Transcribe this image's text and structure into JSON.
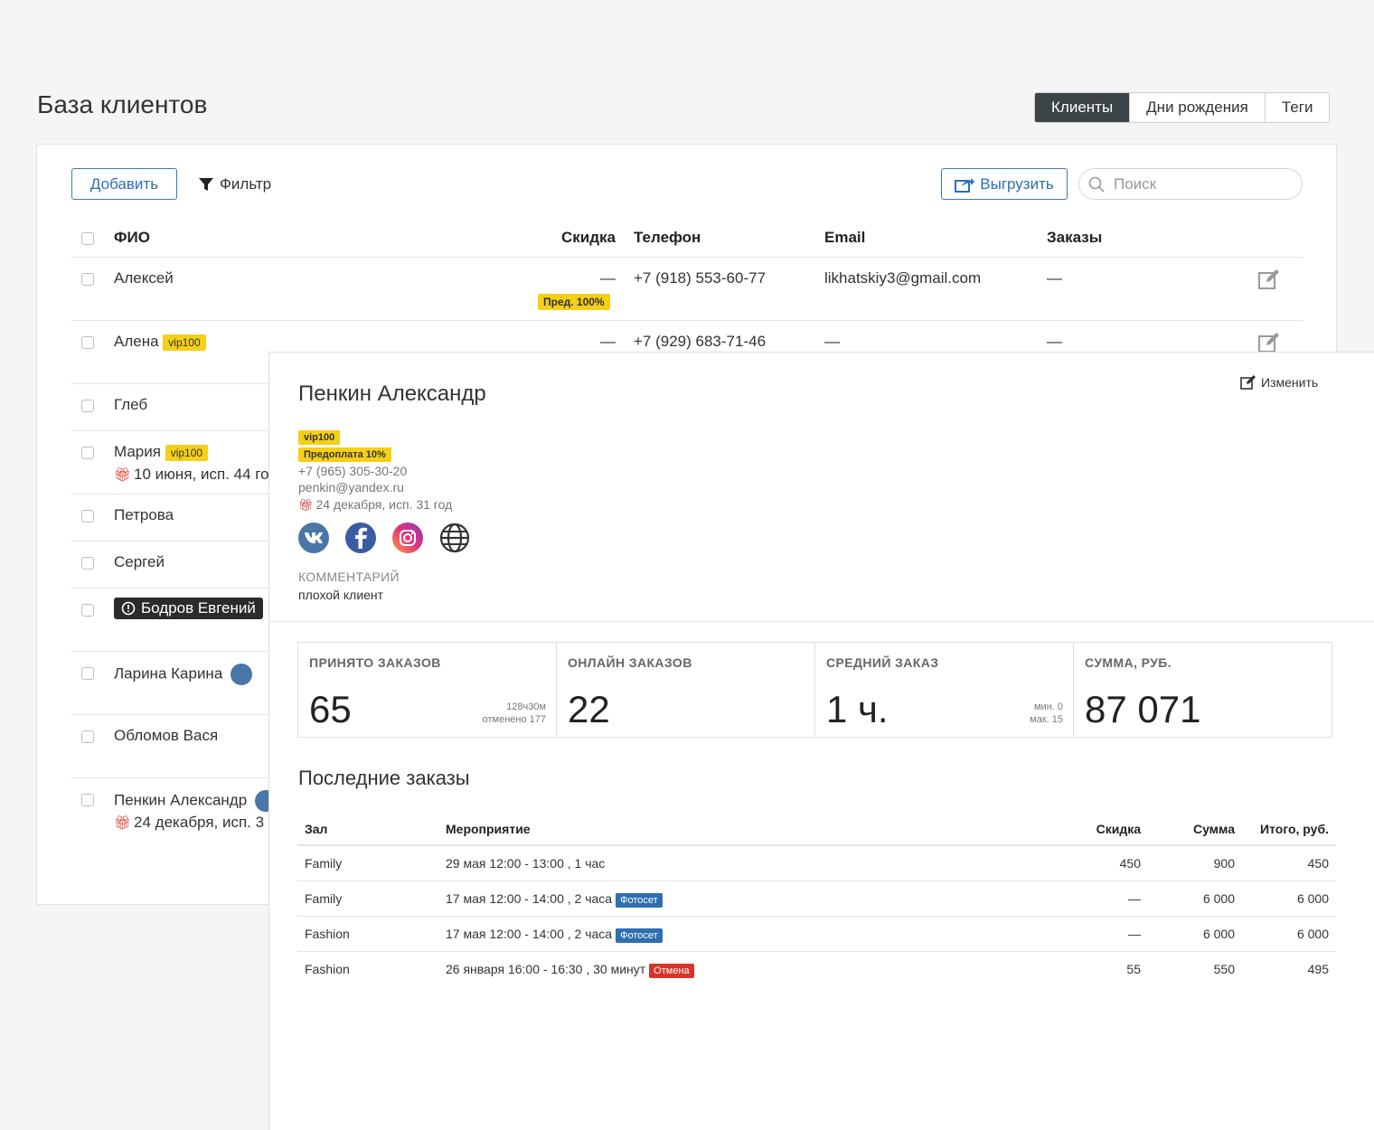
{
  "page": {
    "title": "База клиентов"
  },
  "view_tabs": [
    {
      "label": "Клиенты",
      "active": true
    },
    {
      "label": "Дни рождения",
      "active": false
    },
    {
      "label": "Теги",
      "active": false
    }
  ],
  "toolbar": {
    "add_label": "Добавить",
    "filter_label": "Фильтр",
    "export_label": "Выгрузить",
    "search_placeholder": "Поиск"
  },
  "table": {
    "headers": {
      "name": "ФИО",
      "discount": "Скидка",
      "phone": "Телефон",
      "email": "Email",
      "orders": "Заказы"
    },
    "rows": [
      {
        "name": "Алексей",
        "discount": "—",
        "discount_tag": "Пред. 100%",
        "phone": "+7 (918) 553-60-77",
        "email": "likhatskiy3@gmail.com",
        "orders": "—"
      },
      {
        "name": "Алена",
        "tag": "vip100",
        "discount": "—",
        "phone": "+7 (929) 683-71-46",
        "email": "—",
        "orders": "—"
      },
      {
        "name": "Глеб"
      },
      {
        "name": "Мария",
        "tag": "vip100",
        "birthday": "10 июня, исп. 44 го"
      },
      {
        "name": "Петрова"
      },
      {
        "name": "Сергей"
      },
      {
        "name": "Бодров Евгений"
      },
      {
        "name": "Ларина Карина"
      },
      {
        "name": "Обломов Вася"
      },
      {
        "name": "Пенкин Александр",
        "birthday": "24 декабря, исп. 3"
      }
    ]
  },
  "detail": {
    "name": "Пенкин Александр",
    "edit_label": "Изменить",
    "tags": [
      "vip100",
      "Предоплата 10%"
    ],
    "phone": "+7 (965) 305-30-20",
    "email": "penkin@yandex.ru",
    "birthday": "24 декабря, исп. 31 год",
    "socials": [
      "vk-icon",
      "facebook-icon",
      "instagram-icon",
      "globe-icon"
    ],
    "comment_label": "КОММЕНТАРИЙ",
    "comment": "плохой клиент",
    "stats": [
      {
        "label": "ПРИНЯТО ЗАКАЗОВ",
        "value": "65",
        "sub1": "128ч30м",
        "sub2": "отменено 177"
      },
      {
        "label": "ОНЛАЙН ЗАКАЗОВ",
        "value": "22",
        "sub1": "",
        "sub2": ""
      },
      {
        "label": "СРЕДНИЙ ЗАКАЗ",
        "value": "1 ч.",
        "sub1": "мин. 0",
        "sub2": "мак. 15"
      },
      {
        "label": "СУММА, РУБ.",
        "value": "87 071",
        "sub1": "",
        "sub2": ""
      }
    ],
    "recent_title": "Последние заказы",
    "orders_headers": {
      "hall": "Зал",
      "event": "Мероприятие",
      "discount": "Скидка",
      "sum": "Сумма",
      "total": "Итого, руб."
    },
    "orders": [
      {
        "hall": "Family",
        "event": "29 мая 12:00 - 13:00 , 1 час",
        "badge": "",
        "discount": "450",
        "sum": "900",
        "total": "450"
      },
      {
        "hall": "Family",
        "event": "17 мая 12:00 - 14:00 , 2 часа",
        "badge": "Фотосет",
        "discount": "—",
        "sum": "6 000",
        "total": "6 000"
      },
      {
        "hall": "Fashion",
        "event": "17 мая 12:00 - 14:00 , 2 часа",
        "badge": "Фотосет",
        "discount": "—",
        "sum": "6 000",
        "total": "6 000"
      },
      {
        "hall": "Fashion",
        "event": "26 января 16:00 - 16:30 , 30 минут",
        "badge": "Отмена",
        "discount": "55",
        "sum": "550",
        "total": "495"
      }
    ]
  }
}
